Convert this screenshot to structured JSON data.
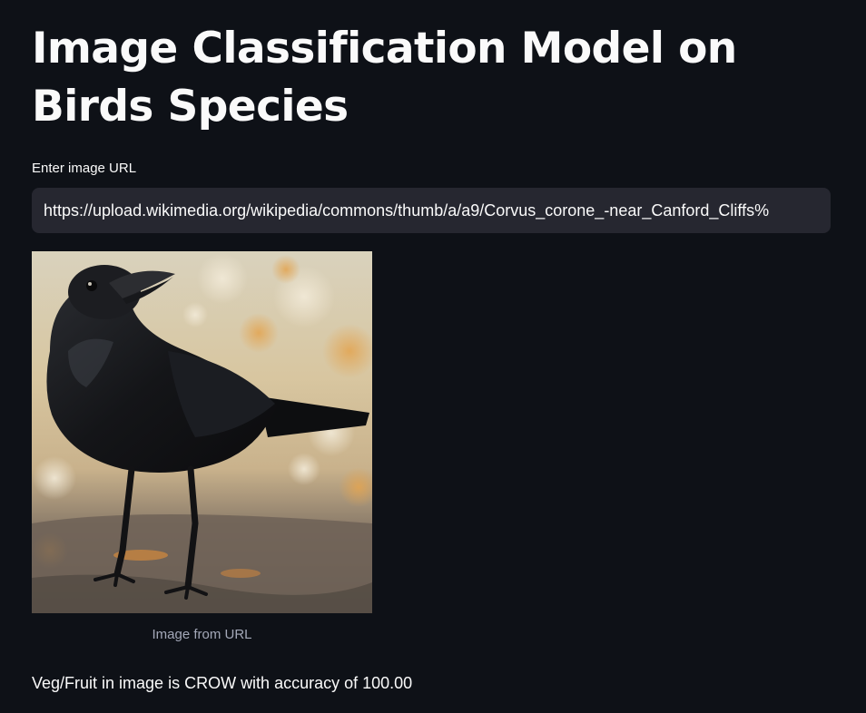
{
  "header": {
    "title": "Image Classification Model on Birds Species"
  },
  "url_input": {
    "label": "Enter image URL",
    "value": "https://upload.wikimedia.org/wikipedia/commons/thumb/a/a9/Corvus_corone_-near_Canford_Cliffs%"
  },
  "image": {
    "caption": "Image from URL"
  },
  "result": {
    "text": "Veg/Fruit in image is CROW with accuracy of 100.00"
  },
  "colors": {
    "background": "#0e1117",
    "input_background": "#262730",
    "text": "#fafafa",
    "caption": "#a3a8b8"
  }
}
